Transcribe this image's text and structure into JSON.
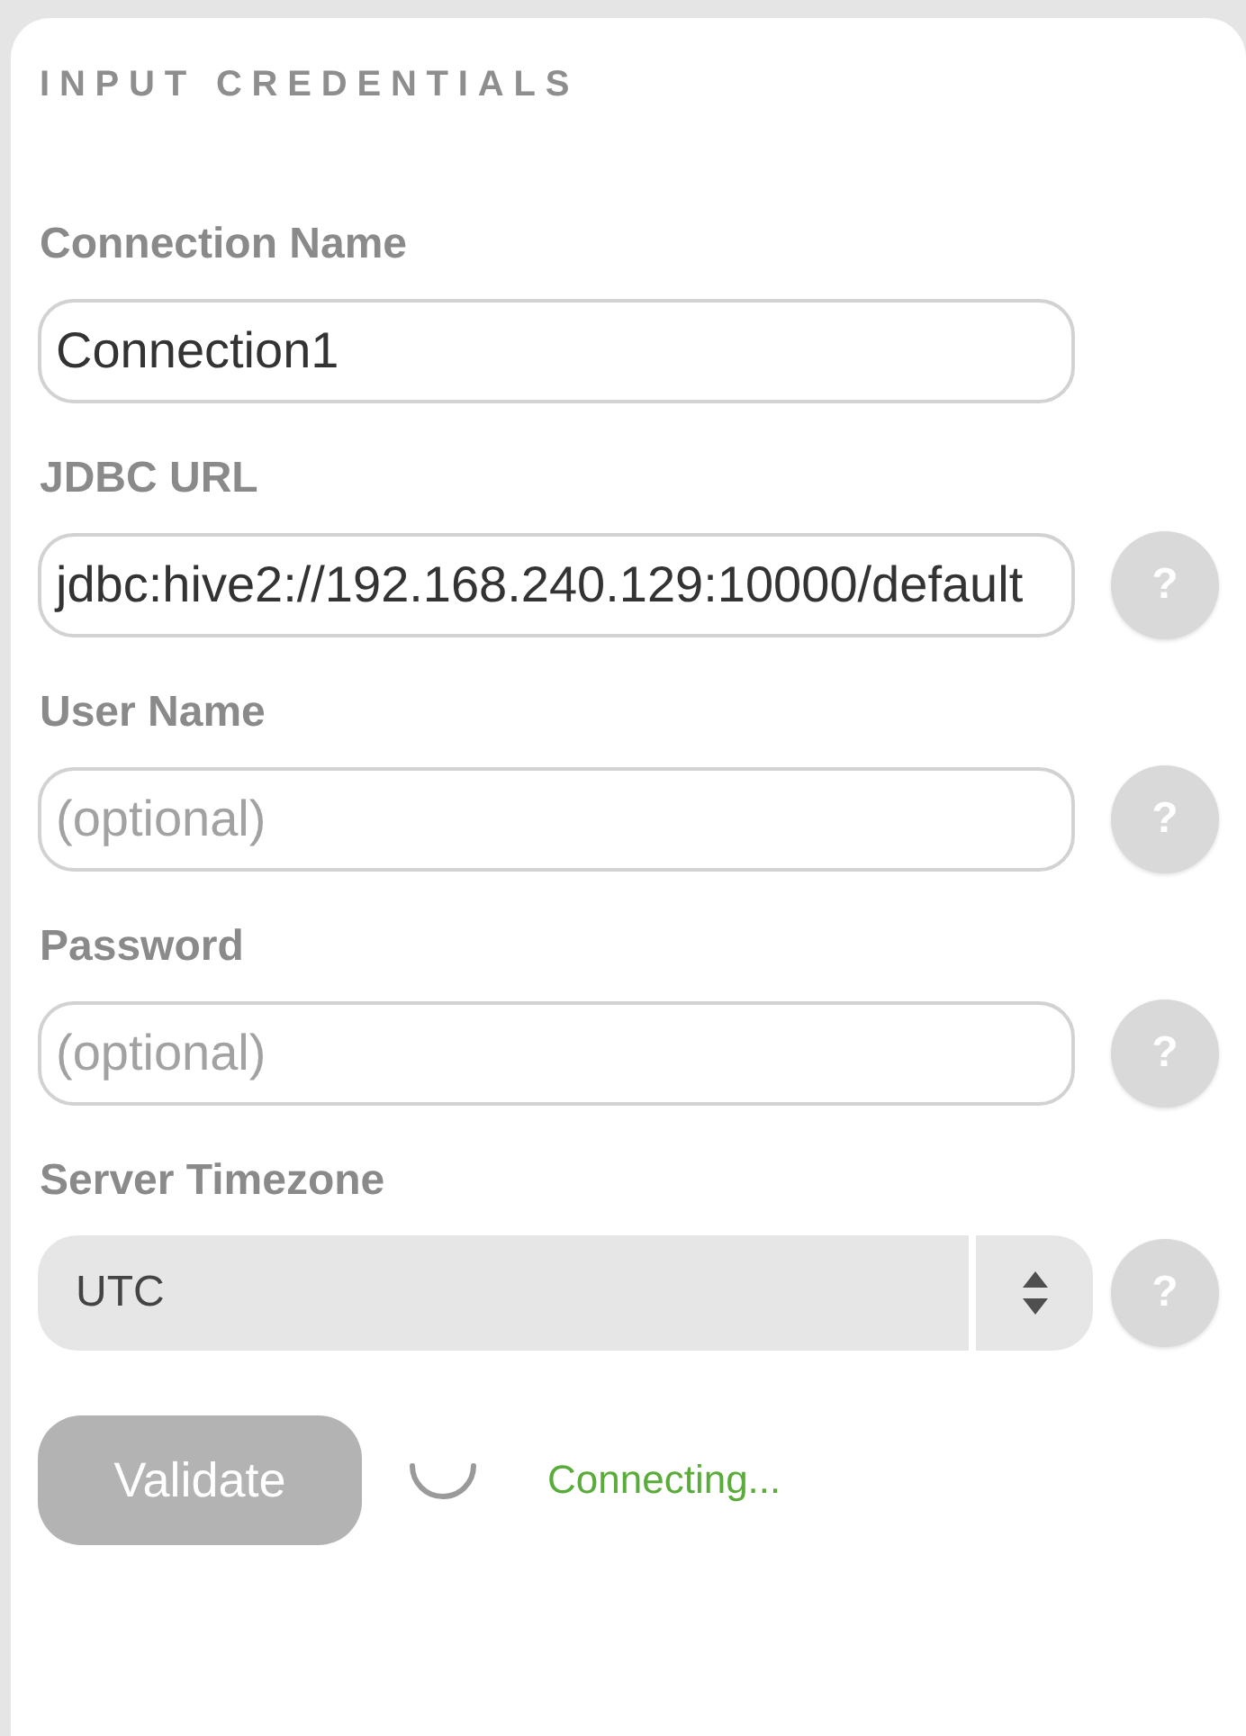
{
  "panel": {
    "title": "INPUT CREDENTIALS"
  },
  "fields": [
    {
      "kind": "text",
      "label": "Connection Name",
      "value": "Connection1"
    },
    {
      "kind": "text",
      "label": "JDBC URL",
      "value": "jdbc:hive2://192.168.240.129:10000/default",
      "help": "?"
    },
    {
      "kind": "text",
      "label": "User Name",
      "placeholder": "(optional)",
      "help": "?"
    },
    {
      "kind": "password",
      "label": "Password",
      "placeholder": "(optional)",
      "help": "?"
    },
    {
      "kind": "select",
      "label": "Server Timezone",
      "value": "UTC",
      "help": "?"
    }
  ],
  "validate_button": {
    "label": "Validate",
    "disabled": true
  },
  "status": {
    "busy": true,
    "text": "Connecting..."
  }
}
